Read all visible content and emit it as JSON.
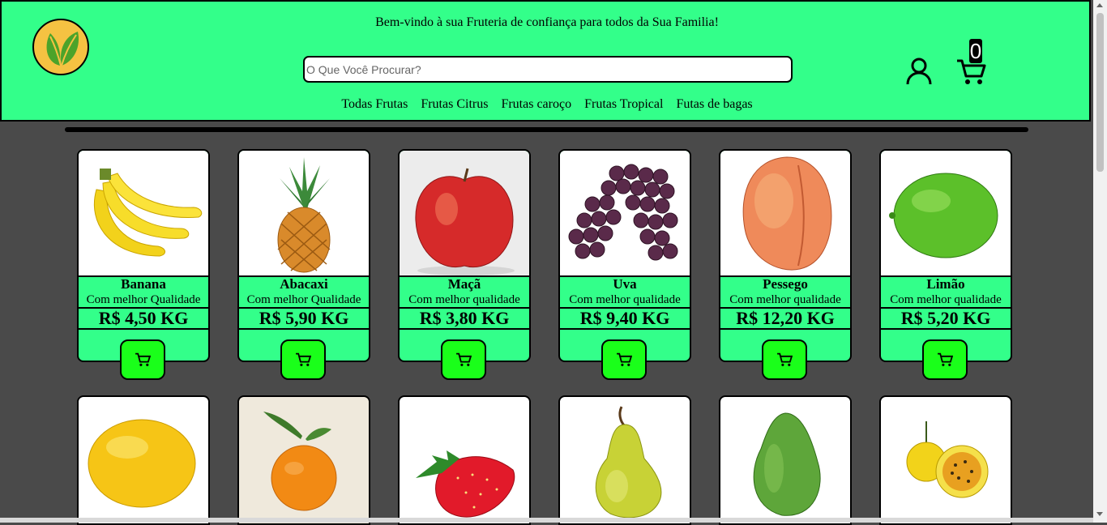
{
  "header": {
    "welcome": "Bem-vindo à sua Fruteria de confiança para todos da Sua Familia!",
    "search_placeholder": "O Que Você Procurar?",
    "cart_count": "0",
    "nav": [
      "Todas Frutas",
      "Frutas Citrus",
      "Frutas caroço",
      "Frutas Tropical",
      "Futas de bagas"
    ]
  },
  "products": [
    {
      "name": "Banana",
      "desc": "Com melhor Qualidade",
      "price": "R$ 4,50 KG",
      "icon": "banana"
    },
    {
      "name": "Abacaxi",
      "desc": "Com melhor Qualidade",
      "price": "R$ 5,90 KG",
      "icon": "pineapple"
    },
    {
      "name": "Maçã",
      "desc": "Com melhor qualidade",
      "price": "R$ 3,80 KG",
      "icon": "apple"
    },
    {
      "name": "Uva",
      "desc": "Com melhor qualidade",
      "price": "R$ 9,40 KG",
      "icon": "grapes"
    },
    {
      "name": "Pessego",
      "desc": "Com melhor qualidade",
      "price": "R$ 12,20 KG",
      "icon": "peach"
    },
    {
      "name": "Limão",
      "desc": "Com melhor qualidade",
      "price": "R$ 5,20 KG",
      "icon": "lime"
    }
  ],
  "products_row2_icons": [
    "melon",
    "orange",
    "strawberry",
    "pear",
    "avocado",
    "passion-fruit"
  ],
  "colors": {
    "header_bg": "#33ff8a",
    "page_bg": "#4a4a4a",
    "buy_button": "#1aff1a"
  }
}
